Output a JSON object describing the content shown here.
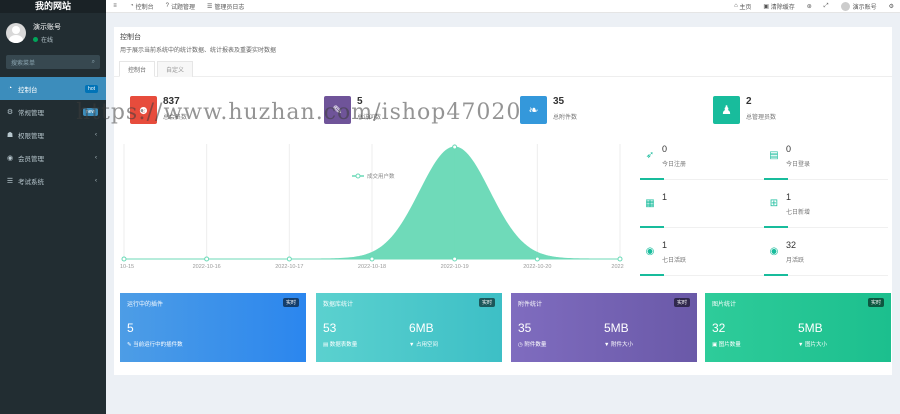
{
  "brand": "我的网站",
  "user": {
    "name": "演示账号",
    "status": "在线"
  },
  "search": {
    "placeholder": "搜索菜单"
  },
  "menu": [
    {
      "label": "控制台",
      "badge": "hot",
      "active": true,
      "icon": "dashboard-icon"
    },
    {
      "label": "常规管理",
      "badge": "new",
      "icon": "cogs-icon"
    },
    {
      "label": "权限管理",
      "icon": "group-icon"
    },
    {
      "label": "会员管理",
      "icon": "user-circle-icon"
    },
    {
      "label": "考试系统",
      "icon": "list-icon"
    }
  ],
  "topbar": {
    "tabs": [
      {
        "label": "控制台",
        "icon": "dashboard-icon"
      },
      {
        "label": "试题管理",
        "icon": "question-icon"
      },
      {
        "label": "管理员日志",
        "icon": "list-icon"
      }
    ],
    "right": {
      "home": "主页",
      "clear_cache": "清除缓存",
      "account": "演示账号"
    }
  },
  "panel": {
    "title": "控制台",
    "description": "用于展示当前系统中的统计数据、统计报表及重要实时数据",
    "tabs": [
      "控制台",
      "自定义"
    ]
  },
  "stats": [
    {
      "value": "837",
      "label": "总会员数",
      "color": "#e74c3c",
      "icon": "users-icon"
    },
    {
      "value": "5",
      "label": "总访问数",
      "color": "#6f5499",
      "icon": "magic-icon"
    },
    {
      "value": "35",
      "label": "总附件数",
      "color": "#3498db",
      "icon": "leaf-icon"
    },
    {
      "value": "2",
      "label": "总管理员数",
      "color": "#18bc9c",
      "icon": "user-icon"
    }
  ],
  "chart_data": {
    "type": "area",
    "series": [
      {
        "name": "成交用户数"
      }
    ],
    "x": [
      "10-15",
      "2022-10-16",
      "2022-10-17",
      "2022-10-18",
      "2022-10-19",
      "2022-10-20",
      "2022-1"
    ],
    "color": "#68d9b6"
  },
  "mini_stats": [
    {
      "value": "0",
      "label": "今日注册",
      "icon": "rocket-icon"
    },
    {
      "value": "0",
      "label": "今日登录",
      "icon": "vcard-icon"
    },
    {
      "value": "1",
      "label": "",
      "icon": "calendar-icon"
    },
    {
      "value": "1",
      "label": "七日新增",
      "icon": "calendar-plus-icon"
    },
    {
      "value": "1",
      "label": "七日活跃",
      "icon": "user-circle-icon"
    },
    {
      "value": "32",
      "label": "月活跃",
      "icon": "user-circle-icon"
    }
  ],
  "cards": [
    {
      "title": "运行中的插件",
      "badge": "实时",
      "value1": "5",
      "sub1": "当前运行中的插件数",
      "color": "linear-gradient(90deg,#4d9de6,#2b86ee)"
    },
    {
      "title": "数据库统计",
      "badge": "实时",
      "value1": "53",
      "sub1": "数据表数量",
      "value2": "6MB",
      "sub2": "占用空间",
      "color": "linear-gradient(90deg,#5bd1cf,#3dbfc6)"
    },
    {
      "title": "附件统计",
      "badge": "实时",
      "value1": "35",
      "sub1": "附件数量",
      "value2": "5MB",
      "sub2": "附件大小",
      "color": "linear-gradient(90deg,#7f6cbf,#6a59a8)"
    },
    {
      "title": "图片统计",
      "badge": "实时",
      "value1": "32",
      "sub1": "图片数量",
      "value2": "5MB",
      "sub2": "图片大小",
      "color": "linear-gradient(90deg,#2ecc9a,#1cbf8e)"
    }
  ],
  "watermark": "https://www.huzhan.com/ishop47020"
}
